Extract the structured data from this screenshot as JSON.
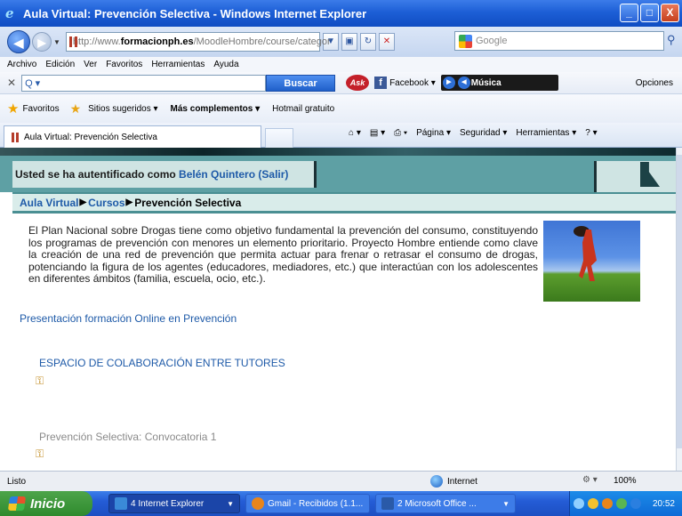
{
  "window": {
    "title": "Aula Virtual: Prevención Selectiva - Windows Internet Explorer",
    "min": "_",
    "max": "□",
    "close": "X"
  },
  "addressbar": {
    "url_prefix": "http://www.",
    "url_domain": "formacionph.es",
    "url_rest": "/MoodleHombre/course/categor",
    "search_placeholder": "Google"
  },
  "menu": [
    "Archivo",
    "Edición",
    "Ver",
    "Favoritos",
    "Herramientas",
    "Ayuda"
  ],
  "asktoolbar": {
    "search_value": "Q ▾",
    "buscar": "Buscar",
    "ask": "Ask",
    "facebook": "Facebook ▾",
    "musica": "Música",
    "opciones": "Opciones"
  },
  "favbar": {
    "favoritos": "Favoritos",
    "sitios": "Sitios sugeridos ▾",
    "complementos": "Más complementos ▾",
    "hotmail": "Hotmail gratuito"
  },
  "tab": {
    "label": "Aula Virtual: Prevención Selectiva"
  },
  "cmdbar": [
    "Página ▾",
    "Seguridad ▾",
    "Herramientas ▾"
  ],
  "page": {
    "auth_prefix": "Usted se ha autentificado como ",
    "auth_user": "Belén Quintero",
    "auth_logout": "(Salir)",
    "crumb_1": "Aula Virtual",
    "crumb_2": "Cursos",
    "crumb_3": "Prevención Selectiva",
    "intro": "El Plan Nacional sobre Drogas tiene como objetivo fundamental la prevención del consumo, constituyendo los programas de prevención con menores un elemento prioritario. Proyecto Hombre entiende como clave la creación de una red de prevención que permita actuar para frenar o retrasar el consumo de drogas, potenciando la figura de los agentes (educadores, mediadores, etc.) que interactúan con los adolescentes en diferentes ámbitos (familia, escuela, ocio, etc.).",
    "link_presentacion": "Presentación formación Online en Prevención",
    "link_espacio": "ESPACIO DE COLABORACIÓN ENTRE TUTORES",
    "link_convocatoria": "Prevención Selectiva: Convocatoria 1"
  },
  "statusbar": {
    "status": "Listo",
    "zone": "Internet",
    "zoom": "100%"
  },
  "taskbar": {
    "start": "Inicio",
    "task_ie": "4 Internet Explorer",
    "task_gmail": "Gmail - Recibidos (1.1...",
    "task_office": "2 Microsoft Office ...",
    "clock": "20:52"
  },
  "colors": {
    "accent": "#1e5aa8",
    "banner": "#5ea0a4",
    "taskbar": "#245cd6"
  }
}
